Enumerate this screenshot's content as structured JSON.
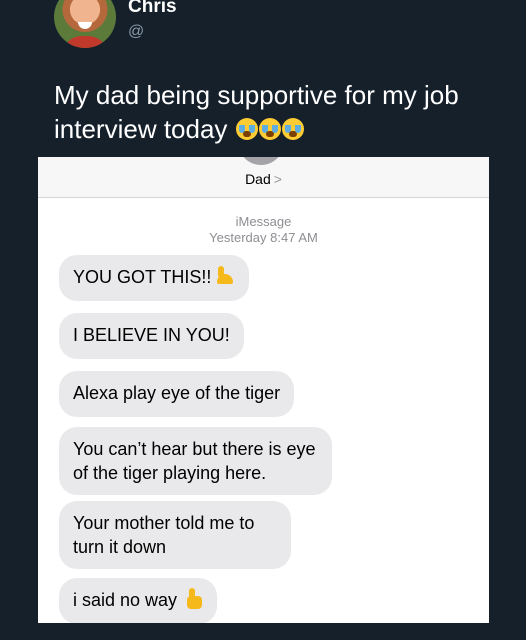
{
  "tweet": {
    "author_name": "Chris",
    "author_handle": "@",
    "text": "My dad being supportive for my job interview today",
    "text_emoji": "loudly-crying-face-icon"
  },
  "imessage": {
    "contact_name": "Dad",
    "contact_chevron": ">",
    "service_label": "iMessage",
    "timestamp": "Yesterday 8:47 AM",
    "messages": [
      {
        "text": "YOU GOT THIS!!",
        "emoji": "flexed-biceps-icon"
      },
      {
        "text": "I BELIEVE IN YOU!"
      },
      {
        "text": "Alexa play eye of the tiger"
      },
      {
        "text": "You can’t hear but there is eye of the tiger playing here."
      },
      {
        "text": "Your mother told me to turn it down"
      },
      {
        "text": "i said no way",
        "emoji": "thumbs-up-icon"
      }
    ]
  },
  "colors": {
    "background": "#15202b",
    "bubble": "#e9e9eb",
    "meta_text": "#8e8e93"
  }
}
